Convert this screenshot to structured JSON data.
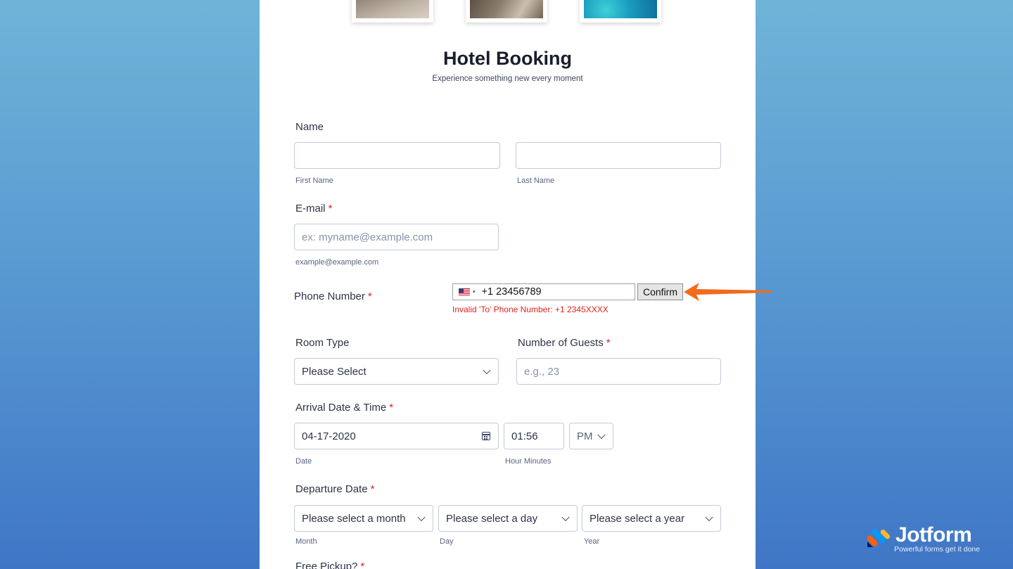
{
  "form": {
    "title": "Hotel Booking",
    "subtitle": "Experience something new every moment",
    "required_mark": "*",
    "name": {
      "label": "Name",
      "first_sublabel": "First Name",
      "last_sublabel": "Last Name"
    },
    "email": {
      "label": "E-mail",
      "placeholder": "ex: myname@example.com",
      "sublabel": "example@example.com"
    },
    "phone": {
      "label": "Phone Number",
      "value": "+1 23456789",
      "flag_icon": "us-flag-icon",
      "caret": "▾",
      "confirm_label": "Confirm",
      "error": "Invalid 'To' Phone Number: +1 2345XXXX"
    },
    "room_type": {
      "label": "Room Type",
      "value": "Please Select"
    },
    "guests": {
      "label": "Number of Guests",
      "placeholder": "e.g., 23"
    },
    "arrival": {
      "label": "Arrival Date & Time",
      "date_value": "04-17-2020",
      "date_sublabel": "Date",
      "time_value": "01:56",
      "time_sublabel": "Hour Minutes",
      "ampm_value": "PM"
    },
    "departure": {
      "label": "Departure Date",
      "month_value": "Please select a month",
      "day_value": "Please select a day",
      "year_value": "Please select a year",
      "month_sublabel": "Month",
      "day_sublabel": "Day",
      "year_sublabel": "Year"
    },
    "pickup": {
      "label": "Free Pickup?"
    }
  },
  "annotation": {
    "arrow_color": "#f26b1d"
  },
  "brand": {
    "name": "Jotform",
    "tagline": "Powerful forms get it done"
  }
}
